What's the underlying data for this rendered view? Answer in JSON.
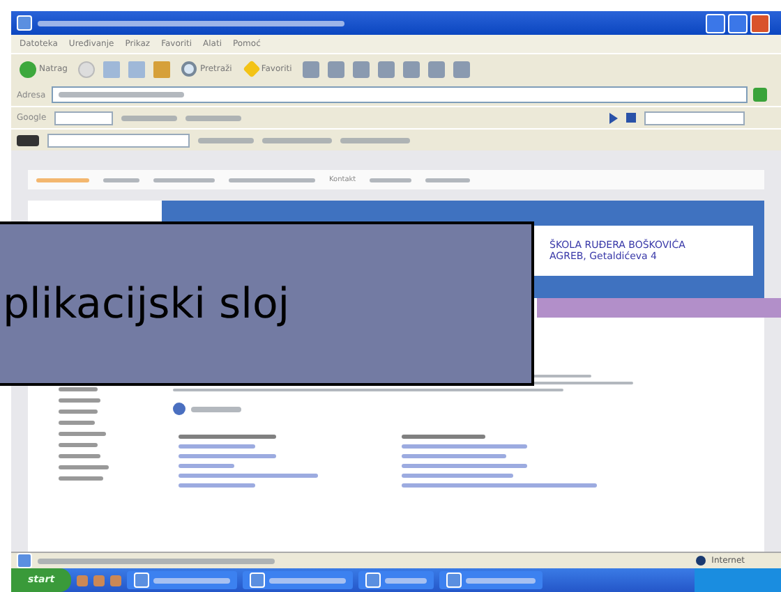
{
  "slide": {
    "title": "plikacijski sloj"
  },
  "browser": {
    "menu": [
      "Datoteka",
      "Uređivanje",
      "Prikaz",
      "Favoriti",
      "Alati",
      "Pomoć"
    ],
    "toolbar": [
      {
        "kind": "back",
        "label": "Natrag"
      },
      {
        "kind": "search",
        "label": "Pretraži"
      },
      {
        "kind": "favorites",
        "label": "Favoriti"
      }
    ],
    "address_label": "Adresa",
    "search_brand": "Google"
  },
  "site": {
    "nav": [
      {
        "selected": true
      },
      {
        "selected": false
      },
      {
        "selected": false
      },
      {
        "selected": false
      },
      {
        "label": "Kontakt",
        "selected": false
      },
      {
        "selected": false
      },
      {
        "selected": false
      }
    ],
    "header": [
      "ŠKOLA RUĐERA BOŠKOVIĆA",
      "AGREB, Getaldićeva 4"
    ]
  },
  "status_bar": {
    "zone": "Internet"
  },
  "taskbar": {
    "start": "start"
  }
}
